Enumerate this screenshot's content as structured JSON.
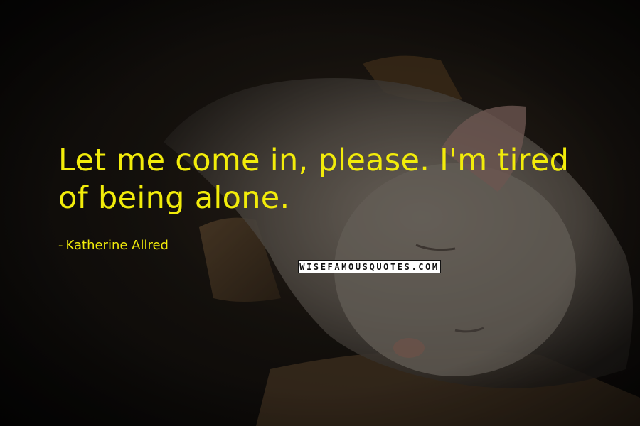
{
  "quote": {
    "line1": "Let me come in, please. I'm tired",
    "line2": "of being alone."
  },
  "author": {
    "dash": "-",
    "name": "Katherine Allred"
  },
  "watermark": {
    "text": "WISEFAMOUSQUOTES.COM"
  },
  "colors": {
    "text": "#f2ec0a",
    "background": "#0d0b09"
  }
}
